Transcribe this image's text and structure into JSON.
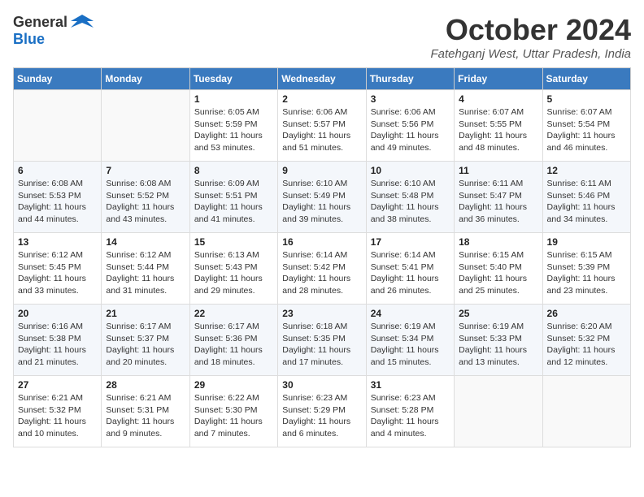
{
  "logo": {
    "general": "General",
    "blue": "Blue"
  },
  "title": "October 2024",
  "location": "Fatehganj West, Uttar Pradesh, India",
  "days_of_week": [
    "Sunday",
    "Monday",
    "Tuesday",
    "Wednesday",
    "Thursday",
    "Friday",
    "Saturday"
  ],
  "weeks": [
    [
      {
        "day": "",
        "info": ""
      },
      {
        "day": "",
        "info": ""
      },
      {
        "day": "1",
        "info": "Sunrise: 6:05 AM\nSunset: 5:59 PM\nDaylight: 11 hours and 53 minutes."
      },
      {
        "day": "2",
        "info": "Sunrise: 6:06 AM\nSunset: 5:57 PM\nDaylight: 11 hours and 51 minutes."
      },
      {
        "day": "3",
        "info": "Sunrise: 6:06 AM\nSunset: 5:56 PM\nDaylight: 11 hours and 49 minutes."
      },
      {
        "day": "4",
        "info": "Sunrise: 6:07 AM\nSunset: 5:55 PM\nDaylight: 11 hours and 48 minutes."
      },
      {
        "day": "5",
        "info": "Sunrise: 6:07 AM\nSunset: 5:54 PM\nDaylight: 11 hours and 46 minutes."
      }
    ],
    [
      {
        "day": "6",
        "info": "Sunrise: 6:08 AM\nSunset: 5:53 PM\nDaylight: 11 hours and 44 minutes."
      },
      {
        "day": "7",
        "info": "Sunrise: 6:08 AM\nSunset: 5:52 PM\nDaylight: 11 hours and 43 minutes."
      },
      {
        "day": "8",
        "info": "Sunrise: 6:09 AM\nSunset: 5:51 PM\nDaylight: 11 hours and 41 minutes."
      },
      {
        "day": "9",
        "info": "Sunrise: 6:10 AM\nSunset: 5:49 PM\nDaylight: 11 hours and 39 minutes."
      },
      {
        "day": "10",
        "info": "Sunrise: 6:10 AM\nSunset: 5:48 PM\nDaylight: 11 hours and 38 minutes."
      },
      {
        "day": "11",
        "info": "Sunrise: 6:11 AM\nSunset: 5:47 PM\nDaylight: 11 hours and 36 minutes."
      },
      {
        "day": "12",
        "info": "Sunrise: 6:11 AM\nSunset: 5:46 PM\nDaylight: 11 hours and 34 minutes."
      }
    ],
    [
      {
        "day": "13",
        "info": "Sunrise: 6:12 AM\nSunset: 5:45 PM\nDaylight: 11 hours and 33 minutes."
      },
      {
        "day": "14",
        "info": "Sunrise: 6:12 AM\nSunset: 5:44 PM\nDaylight: 11 hours and 31 minutes."
      },
      {
        "day": "15",
        "info": "Sunrise: 6:13 AM\nSunset: 5:43 PM\nDaylight: 11 hours and 29 minutes."
      },
      {
        "day": "16",
        "info": "Sunrise: 6:14 AM\nSunset: 5:42 PM\nDaylight: 11 hours and 28 minutes."
      },
      {
        "day": "17",
        "info": "Sunrise: 6:14 AM\nSunset: 5:41 PM\nDaylight: 11 hours and 26 minutes."
      },
      {
        "day": "18",
        "info": "Sunrise: 6:15 AM\nSunset: 5:40 PM\nDaylight: 11 hours and 25 minutes."
      },
      {
        "day": "19",
        "info": "Sunrise: 6:15 AM\nSunset: 5:39 PM\nDaylight: 11 hours and 23 minutes."
      }
    ],
    [
      {
        "day": "20",
        "info": "Sunrise: 6:16 AM\nSunset: 5:38 PM\nDaylight: 11 hours and 21 minutes."
      },
      {
        "day": "21",
        "info": "Sunrise: 6:17 AM\nSunset: 5:37 PM\nDaylight: 11 hours and 20 minutes."
      },
      {
        "day": "22",
        "info": "Sunrise: 6:17 AM\nSunset: 5:36 PM\nDaylight: 11 hours and 18 minutes."
      },
      {
        "day": "23",
        "info": "Sunrise: 6:18 AM\nSunset: 5:35 PM\nDaylight: 11 hours and 17 minutes."
      },
      {
        "day": "24",
        "info": "Sunrise: 6:19 AM\nSunset: 5:34 PM\nDaylight: 11 hours and 15 minutes."
      },
      {
        "day": "25",
        "info": "Sunrise: 6:19 AM\nSunset: 5:33 PM\nDaylight: 11 hours and 13 minutes."
      },
      {
        "day": "26",
        "info": "Sunrise: 6:20 AM\nSunset: 5:32 PM\nDaylight: 11 hours and 12 minutes."
      }
    ],
    [
      {
        "day": "27",
        "info": "Sunrise: 6:21 AM\nSunset: 5:32 PM\nDaylight: 11 hours and 10 minutes."
      },
      {
        "day": "28",
        "info": "Sunrise: 6:21 AM\nSunset: 5:31 PM\nDaylight: 11 hours and 9 minutes."
      },
      {
        "day": "29",
        "info": "Sunrise: 6:22 AM\nSunset: 5:30 PM\nDaylight: 11 hours and 7 minutes."
      },
      {
        "day": "30",
        "info": "Sunrise: 6:23 AM\nSunset: 5:29 PM\nDaylight: 11 hours and 6 minutes."
      },
      {
        "day": "31",
        "info": "Sunrise: 6:23 AM\nSunset: 5:28 PM\nDaylight: 11 hours and 4 minutes."
      },
      {
        "day": "",
        "info": ""
      },
      {
        "day": "",
        "info": ""
      }
    ]
  ]
}
